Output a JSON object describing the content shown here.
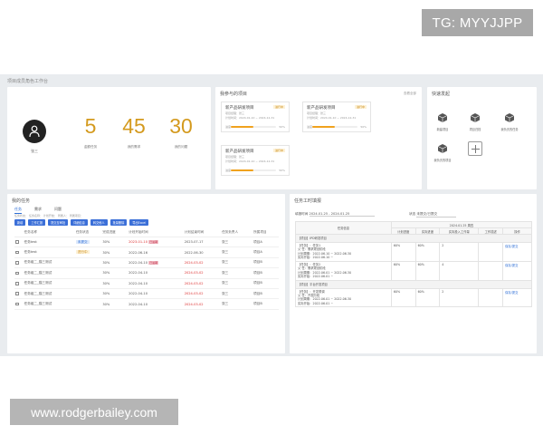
{
  "watermarks": {
    "top": "TG: MYYJJPP",
    "bottom": "www.rodgerbailey.com"
  },
  "app_title": "项目成员角色工作台",
  "profile": {
    "name": "张三",
    "stats": [
      {
        "value": "5",
        "label": "金额任务"
      },
      {
        "value": "45",
        "label": "我的需求"
      },
      {
        "value": "30",
        "label": "我的问题"
      }
    ]
  },
  "projects": {
    "title": "我参与的项目",
    "more": "查看全部",
    "cards": [
      {
        "title": "新产品研发项目",
        "tag": "进行中",
        "line1": "项目经理：张三",
        "line2": "计划时间：2024-01-10 ~ 2024-12-31",
        "lead": "进度",
        "pct": "50%",
        "progress": 0.5
      },
      {
        "title": "新产品研发项目",
        "tag": "进行中",
        "line1": "项目经理：张三",
        "line2": "计划时间：2024-01-10 ~ 2024-12-31",
        "lead": "进度",
        "pct": "50%",
        "progress": 0.5
      },
      {
        "title": "新产品研发项目",
        "tag": "进行中",
        "line1": "项目经理：张三",
        "line2": "计划时间：2024-01-10 ~ 2024-12-31",
        "lead": "进度",
        "pct": "50%",
        "progress": 0.5
      }
    ]
  },
  "quick": {
    "title": "快速发起",
    "items": [
      {
        "label": "新建项目"
      },
      {
        "label": "项目归档"
      },
      {
        "label": "我负责的任务"
      },
      {
        "label": "我负责的项目"
      },
      {
        "label": ""
      }
    ]
  },
  "tasks": {
    "title": "我的任务",
    "tabs": [
      "任务",
      "需求",
      "问题"
    ],
    "filters": "任务状态：  任务名称：  计划开始：  所属人：  所属项目：",
    "buttons": [
      "新增",
      "工作汇报",
      "提交至审批",
      "详细信息",
      "转交他人",
      "批量删除",
      "导出Excel"
    ],
    "columns": [
      "",
      "任务名称",
      "任务状态",
      "完成进度",
      "计划开始时间",
      "计划结束时间",
      "任务负责人",
      "所属项目"
    ],
    "rows": [
      {
        "name": "任务test",
        "status": "未提交",
        "status_type": "blue",
        "progress": "30%",
        "start": "2023-01-10",
        "start_red": true,
        "overdue": "已逾期",
        "end": "2023-07-17",
        "end_red": false,
        "owner": "张三",
        "project": "项目A"
      },
      {
        "name": "任务test",
        "status": "进行中",
        "status_type": "gold",
        "progress": "30%",
        "start": "2022-06-16",
        "start_red": false,
        "overdue": "",
        "end": "2022-06-30",
        "end_red": false,
        "owner": "张三",
        "project": "项目A"
      },
      {
        "name": "任务组二_猫三测试",
        "status": "",
        "status_type": "",
        "progress": "30%",
        "start": "2022-04-10",
        "start_red": false,
        "overdue": "已逾期",
        "end": "2024-03-02",
        "end_red": true,
        "owner": "张三",
        "project": "项目B"
      },
      {
        "name": "任务组二_猫三测试",
        "status": "",
        "status_type": "",
        "progress": "30%",
        "start": "2022-04-10",
        "start_red": false,
        "overdue": "",
        "end": "2024-03-02",
        "end_red": true,
        "owner": "张三",
        "project": "项目B"
      },
      {
        "name": "任务组二_猫三测试",
        "status": "",
        "status_type": "",
        "progress": "30%",
        "start": "2022-04-10",
        "start_red": false,
        "overdue": "",
        "end": "2024-03-02",
        "end_red": true,
        "owner": "张三",
        "project": "项目B"
      },
      {
        "name": "任务组二_猫三测试",
        "status": "",
        "status_type": "",
        "progress": "30%",
        "start": "2022-04-10",
        "start_red": false,
        "overdue": "",
        "end": "2024-03-02",
        "end_red": true,
        "owner": "张三",
        "project": "项目B"
      },
      {
        "name": "任务组二_猫三测试",
        "status": "",
        "status_type": "",
        "progress": "30%",
        "start": "2022-04-10",
        "start_red": false,
        "overdue": "",
        "end": "2024-03-02",
        "end_red": true,
        "owner": "张三",
        "project": "项目B"
      }
    ]
  },
  "hours": {
    "title": "任务工时填报",
    "range_label": "填报时间",
    "range_value": "2024.01.25 - 2024.01.25",
    "status_label": "状态",
    "status_value": "未提交/已提交",
    "date_header": "2024.01.25 周四",
    "columns": [
      "任务信息",
      "计划进度",
      "实际进度",
      "实际投入工作量",
      "工作描述",
      "操作"
    ],
    "groups": [
      {
        "category": "【项目】IPD研发项目",
        "rows": [
          {
            "lines": [
              "【任务】：任务1",
              "父    任：需求规划阶段",
              "计划周期：2022.06.10 ~ 2022.06.30",
              "实际开始：2022.06.10 ~"
            ],
            "plan": "60%",
            "actual": "60%",
            "hours": "2",
            "action": "保存/提交"
          },
          {
            "lines": [
              "【任务】：任务2",
              "父    任：需求规划阶段",
              "计划周期：2022.06.01 ~ 2022.06.30",
              "实际开始：2022.06.01 ~"
            ],
            "plan": "60%",
            "actual": "60%",
            "hours": "4",
            "action": "保存/提交"
          }
        ]
      },
      {
        "category": "【项目】平台开发项目",
        "rows": [
          {
            "lines": [
              "【任务】：开发联调",
              "父    任：开发阶段",
              "计划周期：2022.06.01 ~ 2022.06.30",
              "实际开始：2022.06.01 ~"
            ],
            "plan": "60%",
            "actual": "60%",
            "hours": "2",
            "action": "保存/提交"
          }
        ]
      }
    ]
  }
}
